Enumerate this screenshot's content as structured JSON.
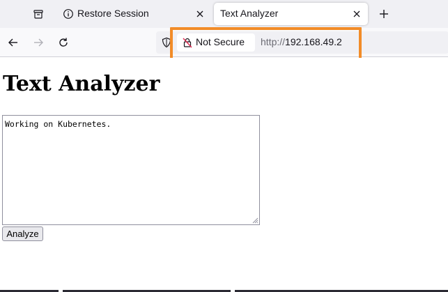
{
  "tabs": [
    {
      "title": "Restore Session",
      "icon": "info-icon",
      "active": false
    },
    {
      "title": "Text Analyzer",
      "icon": "",
      "active": true
    }
  ],
  "urlbar": {
    "security_label": "Not Secure",
    "url_scheme": "http://",
    "url_host": "192.168.49.2"
  },
  "page": {
    "title": "Text Analyzer",
    "textarea_value": "Working on Kubernetes.",
    "analyze_label": "Analyze"
  },
  "colors": {
    "highlight": "#f28c28",
    "tabstrip_bg": "#f0f0f4",
    "navbar_bg": "#f9f9fb"
  }
}
